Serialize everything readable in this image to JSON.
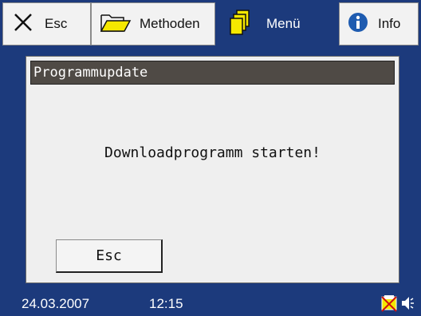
{
  "tabs": [
    {
      "label": "Esc",
      "icon": "close-x-icon"
    },
    {
      "label": "Methoden",
      "icon": "folder-icon"
    },
    {
      "label": "Menü",
      "icon": "documents-icon",
      "active": true
    },
    {
      "label": "Info",
      "icon": "info-icon"
    }
  ],
  "dialog": {
    "title": "Programmupdate",
    "message": "Downloadprogramm starten!",
    "esc_label": "Esc"
  },
  "status": {
    "date": "24.03.2007",
    "time": "12:15",
    "icons": [
      "printer-disabled-icon",
      "speaker-icon"
    ]
  },
  "colors": {
    "frame": "#1c3a7c",
    "panel": "#efefef",
    "header": "#4f4a45",
    "folder": "#f5e800",
    "info": "#1e5bb0"
  }
}
